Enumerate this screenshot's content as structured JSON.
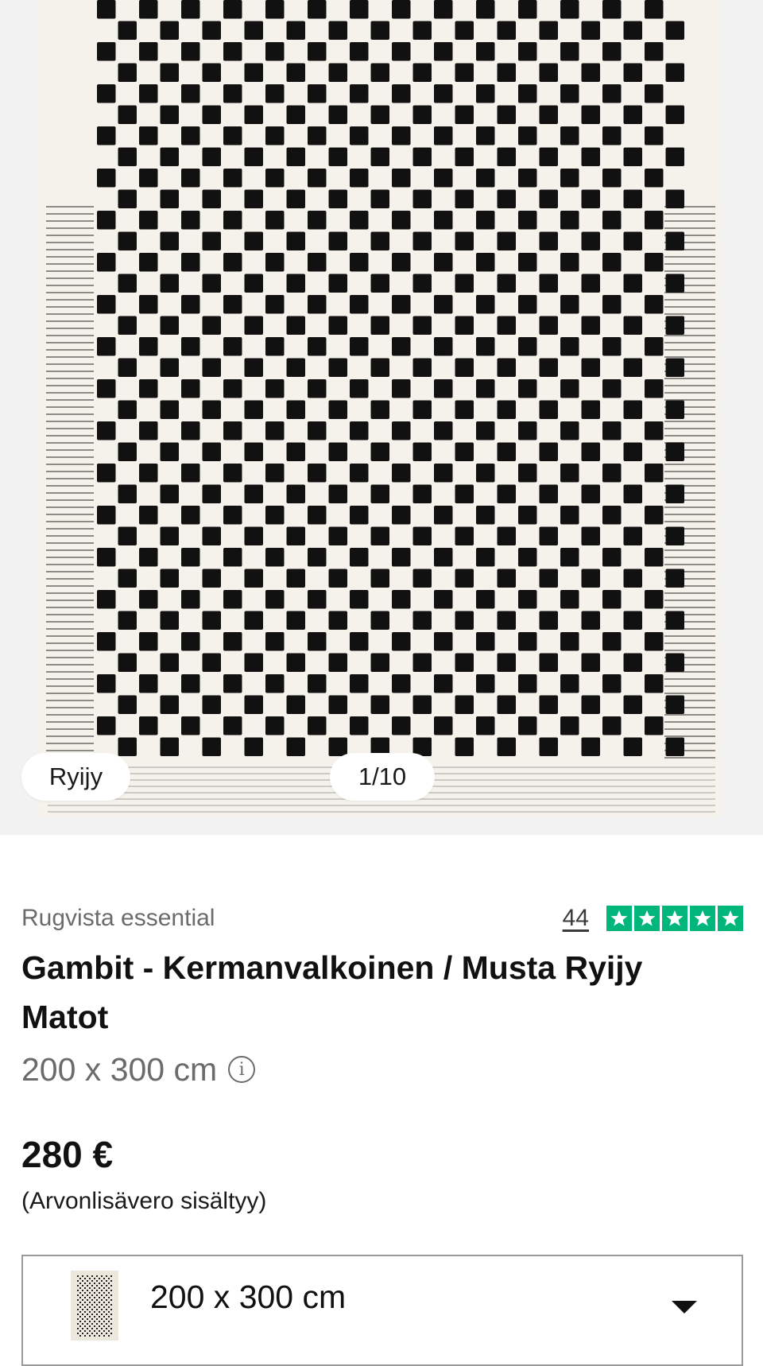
{
  "gallery": {
    "tag": "Ryijy",
    "counter": "1/10"
  },
  "product": {
    "brand": "Rugvista essential",
    "review_count": "44",
    "rating_stars": 5,
    "rating_color": "#00b67a",
    "title": "Gambit - Kermanvalkoinen / Musta Ryijy Matot",
    "size": "200 x 300 cm",
    "price": "280 €",
    "vat_note": "(Arvonlisävero sisältyy)"
  },
  "size_selector": {
    "selected": "200 x 300 cm"
  },
  "icons": {
    "info": "info-circle-icon",
    "star": "star-icon",
    "dropdown": "chevron-down-icon"
  }
}
